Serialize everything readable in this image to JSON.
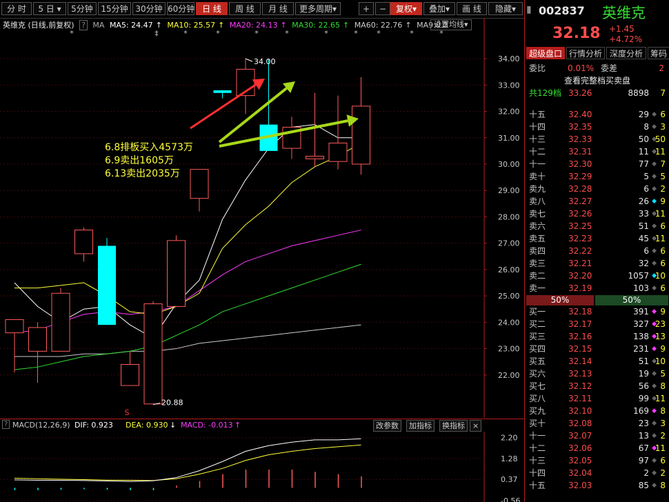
{
  "toolbar": {
    "tabs": [
      "分 时",
      "5 日",
      "5分钟",
      "15分钟",
      "30分钟",
      "60分钟",
      "日 线",
      "周 线",
      "月 线",
      "更多周期"
    ],
    "right_buttons": [
      "+",
      "−",
      "复权",
      "叠加",
      "画 线",
      "隐藏"
    ]
  },
  "legend": {
    "title": "英维克 (日线,前复权)",
    "ma": "MA",
    "ma5": "MA5: 24.47",
    "ma10": "MA10: 25.57",
    "ma20": "MA20: 24.13",
    "ma30": "MA30: 22.65",
    "ma60": "MA60: 22.76",
    "ma9": "MA9:0.2",
    "settings_button": "设置均线"
  },
  "annotations": {
    "lines": [
      "6.8排板买入4573万",
      "6.9卖出1605万",
      "6.13卖出2035万"
    ],
    "high_label": "34.00",
    "low_label": "20.88",
    "s_marker": "S"
  },
  "y_axis_labels": [
    "34.00",
    "33.00",
    "32.00",
    "31.00",
    "30.00",
    "29.00",
    "28.00",
    "27.00",
    "26.00",
    "25.00",
    "24.00",
    "23.00",
    "22.00"
  ],
  "macd": {
    "label": "MACD(12,26,9)",
    "dif": "DIF: 0.923",
    "dea": "DEA: 0.930",
    "macd": "MACD: -0.013",
    "buttons": [
      "改参数",
      "加指标",
      "换指标",
      "×"
    ],
    "y_labels": [
      "2.20",
      "1.28",
      "0.37",
      "-0.56"
    ]
  },
  "chart_data": {
    "type": "candlestick",
    "candles": [
      {
        "o": 23.6,
        "c": 24.1,
        "h": 24.1,
        "l": 22.1
      },
      {
        "o": 22.9,
        "c": 23.8,
        "h": 24.0,
        "l": 21.7
      },
      {
        "o": 22.9,
        "c": 25.1,
        "h": 25.3,
        "l": 22.9
      },
      {
        "o": 26.6,
        "c": 27.5,
        "h": 27.6,
        "l": 26.3
      },
      {
        "o": 26.9,
        "c": 23.9,
        "h": 27.2,
        "l": 23.9
      },
      {
        "o": 21.6,
        "c": 22.4,
        "h": 22.9,
        "l": 21.6
      },
      {
        "o": 20.9,
        "c": 24.7,
        "h": 24.8,
        "l": 20.88
      },
      {
        "o": 24.6,
        "c": 27.1,
        "h": 27.3,
        "l": 24.6
      },
      {
        "o": 28.7,
        "c": 29.8,
        "h": 29.8,
        "l": 28.2
      },
      {
        "o": 32.8,
        "c": 32.7,
        "h": 32.8,
        "l": 32.5
      },
      {
        "o": 32.6,
        "c": 33.6,
        "h": 34.0,
        "l": 31.9
      },
      {
        "o": 31.5,
        "c": 30.5,
        "h": 34.0,
        "l": 30.5
      },
      {
        "o": 30.6,
        "c": 31.4,
        "h": 31.8,
        "l": 30.2
      },
      {
        "o": 30.2,
        "c": 30.3,
        "h": 32.7,
        "l": 29.9
      },
      {
        "o": 30.1,
        "c": 30.8,
        "h": 32.6,
        "l": 29.8
      },
      {
        "o": 30.0,
        "c": 32.2,
        "h": 33.3,
        "l": 29.6
      }
    ],
    "ma5": [
      25.5,
      24.6,
      24.0,
      24.5,
      24.6,
      23.9,
      23.4,
      24.7,
      25.6,
      27.9,
      29.4,
      30.6,
      31.4,
      31.5,
      31.0,
      31.0
    ],
    "ma10": [
      25.3,
      25.3,
      25.4,
      25.5,
      25.0,
      24.4,
      24.3,
      24.6,
      25.1,
      26.8,
      27.7,
      28.4,
      29.3,
      29.9,
      30.3,
      30.8
    ],
    "ma20": [
      23.6,
      23.7,
      24.0,
      24.3,
      24.4,
      24.3,
      24.4,
      24.6,
      25.2,
      25.8,
      26.3,
      26.6,
      26.9,
      27.1,
      27.3,
      27.5
    ],
    "ma30": [
      22.2,
      22.3,
      22.5,
      22.7,
      22.8,
      22.9,
      23.1,
      23.5,
      23.9,
      24.4,
      24.7,
      25.0,
      25.3,
      25.6,
      25.9,
      26.2
    ],
    "ma60": [
      22.7,
      22.7,
      22.7,
      22.8,
      22.8,
      22.9,
      22.9,
      23.0,
      23.2,
      23.3,
      23.4,
      23.5,
      23.6,
      23.7,
      23.8,
      23.9
    ],
    "ylim": [
      21.0,
      34.5
    ],
    "macd_dif": [
      0.35,
      0.33,
      0.33,
      0.32,
      0.3,
      0.28,
      0.31,
      0.45,
      0.75,
      1.15,
      1.6,
      1.85,
      2.0,
      2.1,
      2.1,
      2.15
    ],
    "macd_dea": [
      0.42,
      0.4,
      0.38,
      0.36,
      0.34,
      0.33,
      0.32,
      0.4,
      0.6,
      0.85,
      1.2,
      1.45,
      1.6,
      1.72,
      1.8,
      1.88
    ],
    "macd_hist": [
      -0.1,
      -0.1,
      -0.08,
      -0.06,
      -0.08,
      -0.1,
      -0.1,
      0.1,
      0.3,
      0.6,
      0.8,
      0.8,
      0.8,
      0.7,
      0.6,
      0.5
    ],
    "macd_ylim": [
      -0.56,
      2.4
    ]
  },
  "quote": {
    "code": "002837",
    "name": "英维克",
    "price": "32.18",
    "change": "+1.45",
    "pct": "+4.72%",
    "tabs": [
      "超级盘口",
      "行情分析",
      "深度分析",
      "筹码分"
    ],
    "webi_label": "委比",
    "webi_value": "0.01%",
    "wecha_label": "委差",
    "wecha_value": "2",
    "full_book": "查看完整档买卖盘",
    "total_label": "共129档",
    "total_price": "33.26",
    "total_vol": "8898",
    "total_cnt": "7",
    "ratio_sell": "50%",
    "ratio_buy": "50%",
    "asks": [
      {
        "l": "十五",
        "p": "32.40",
        "v": "29",
        "c": "6",
        "d": "gray"
      },
      {
        "l": "十四",
        "p": "32.35",
        "v": "8",
        "c": "3",
        "d": "gray"
      },
      {
        "l": "十三",
        "p": "32.33",
        "v": "50",
        "c": "50",
        "d": "gray"
      },
      {
        "l": "十二",
        "p": "32.31",
        "v": "11",
        "c": "11",
        "d": "gray"
      },
      {
        "l": "十一",
        "p": "32.30",
        "v": "77",
        "c": "7",
        "d": "gray"
      },
      {
        "l": "卖十",
        "p": "32.29",
        "v": "5",
        "c": "5",
        "d": "gray"
      },
      {
        "l": "卖九",
        "p": "32.28",
        "v": "6",
        "c": "2",
        "d": "gray"
      },
      {
        "l": "卖八",
        "p": "32.27",
        "v": "26",
        "c": "9",
        "d": "cyan"
      },
      {
        "l": "卖七",
        "p": "32.26",
        "v": "33",
        "c": "11",
        "d": "gray"
      },
      {
        "l": "卖六",
        "p": "32.25",
        "v": "51",
        "c": "6",
        "d": "gray"
      },
      {
        "l": "卖五",
        "p": "32.23",
        "v": "45",
        "c": "11",
        "d": "gray"
      },
      {
        "l": "卖四",
        "p": "32.22",
        "v": "6",
        "c": "6",
        "d": "gray"
      },
      {
        "l": "卖三",
        "p": "32.21",
        "v": "32",
        "c": "6",
        "d": "gray"
      },
      {
        "l": "卖二",
        "p": "32.20",
        "v": "1057",
        "c": "10",
        "d": "cyan"
      },
      {
        "l": "卖一",
        "p": "32.19",
        "v": "103",
        "c": "6",
        "d": "gray"
      }
    ],
    "bids": [
      {
        "l": "买一",
        "p": "32.18",
        "v": "391",
        "c": "9",
        "d": "magenta"
      },
      {
        "l": "买二",
        "p": "32.17",
        "v": "327",
        "c": "23",
        "d": "magenta"
      },
      {
        "l": "买三",
        "p": "32.16",
        "v": "138",
        "c": "13",
        "d": "magenta"
      },
      {
        "l": "买四",
        "p": "32.15",
        "v": "231",
        "c": "9",
        "d": "magenta"
      },
      {
        "l": "买五",
        "p": "32.14",
        "v": "51",
        "c": "10",
        "d": "gray"
      },
      {
        "l": "买六",
        "p": "32.13",
        "v": "19",
        "c": "5",
        "d": "gray"
      },
      {
        "l": "买七",
        "p": "32.12",
        "v": "56",
        "c": "8",
        "d": "gray"
      },
      {
        "l": "买八",
        "p": "32.11",
        "v": "99",
        "c": "11",
        "d": "gray"
      },
      {
        "l": "买九",
        "p": "32.10",
        "v": "169",
        "c": "8",
        "d": "magenta"
      },
      {
        "l": "买十",
        "p": "32.08",
        "v": "23",
        "c": "3",
        "d": "gray"
      },
      {
        "l": "十一",
        "p": "32.07",
        "v": "13",
        "c": "2",
        "d": "gray"
      },
      {
        "l": "十二",
        "p": "32.06",
        "v": "67",
        "c": "11",
        "d": "magenta"
      },
      {
        "l": "十三",
        "p": "32.05",
        "v": "97",
        "c": "6",
        "d": "gray"
      },
      {
        "l": "十四",
        "p": "32.04",
        "v": "2",
        "c": "2",
        "d": "gray"
      },
      {
        "l": "十五",
        "p": "32.03",
        "v": "85",
        "c": "8",
        "d": "gray"
      }
    ]
  },
  "colors": {
    "up": "#ff5a5a",
    "down": "#00ffff",
    "ma5": "#ffffff",
    "ma10": "#ffff3a",
    "ma20": "#ff3aff",
    "ma30": "#33dd33",
    "ma60": "#cccccc",
    "arrow_red": "#ff3030",
    "arrow_green": "#a8d81a",
    "annotation": "#ffff3a"
  }
}
